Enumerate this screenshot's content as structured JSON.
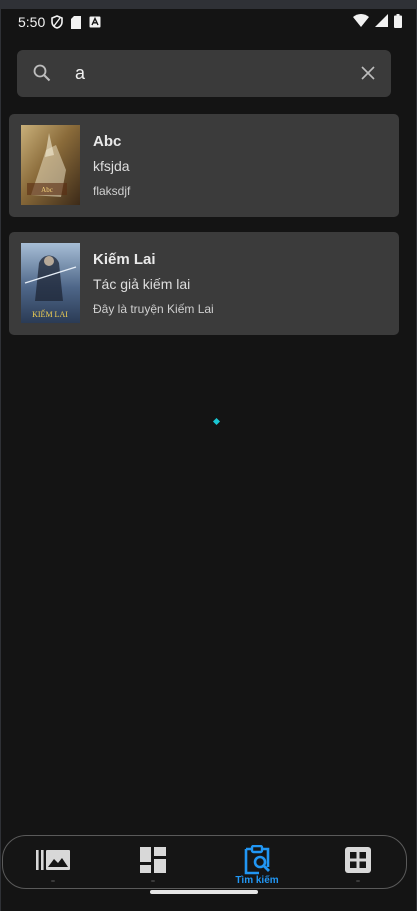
{
  "status_bar": {
    "time": "5:50",
    "left_icons": [
      "shield-icon",
      "sd-card-icon",
      "app-notification-icon"
    ],
    "right_icons": [
      "wifi-icon",
      "signal-icon",
      "battery-icon"
    ]
  },
  "search": {
    "value": "a"
  },
  "results": [
    {
      "title": "Abc",
      "author": "kfsjda",
      "description": "flaksdjf",
      "cover_text": "Abc"
    },
    {
      "title": "Kiếm Lai",
      "author": "Tác giả kiếm lai",
      "description": "Đây là truyện Kiếm Lai",
      "cover_text": "KIẾM LAI"
    }
  ],
  "bottom_nav": {
    "items": [
      {
        "icon": "library-icon",
        "label": "",
        "active": false
      },
      {
        "icon": "dashboard-icon",
        "label": "",
        "active": false
      },
      {
        "icon": "search-clipboard-icon",
        "label": "Tìm kiếm",
        "active": true
      },
      {
        "icon": "apps-grid-icon",
        "label": "",
        "active": false
      }
    ]
  },
  "colors": {
    "accent": "#2196f3",
    "background": "#141414",
    "card": "#3b3b3b",
    "loader": "#19c6d3"
  }
}
